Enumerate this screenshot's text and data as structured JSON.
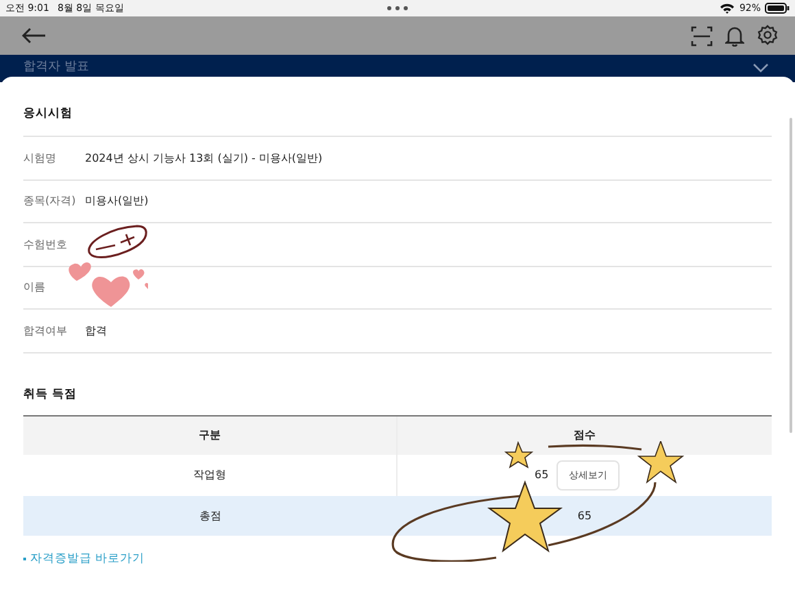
{
  "status_bar": {
    "time": "오전 9:01",
    "date": "8월 8일 목요일",
    "battery": "92%"
  },
  "banner": {
    "title": "합격자 발표"
  },
  "exam_section": {
    "title": "응시시험",
    "rows": [
      {
        "label": "시험명",
        "value": "2024년 상시 기능사 13회 (실기) - 미용사(일반)"
      },
      {
        "label": "종목(자격)",
        "value": "미용사(일반)"
      },
      {
        "label": "수험번호"
      },
      {
        "label": "이름"
      },
      {
        "label": "합격여부",
        "value": "합격"
      }
    ]
  },
  "score_section": {
    "title": "취득 득점",
    "columns": [
      "구분",
      "점수"
    ],
    "rows": [
      {
        "category": "작업형",
        "score": "65",
        "button": "상세보기",
        "highlighted": false
      },
      {
        "category": "총점",
        "score": "65",
        "highlighted": true
      }
    ]
  },
  "link": "자격증발급 바로가기"
}
